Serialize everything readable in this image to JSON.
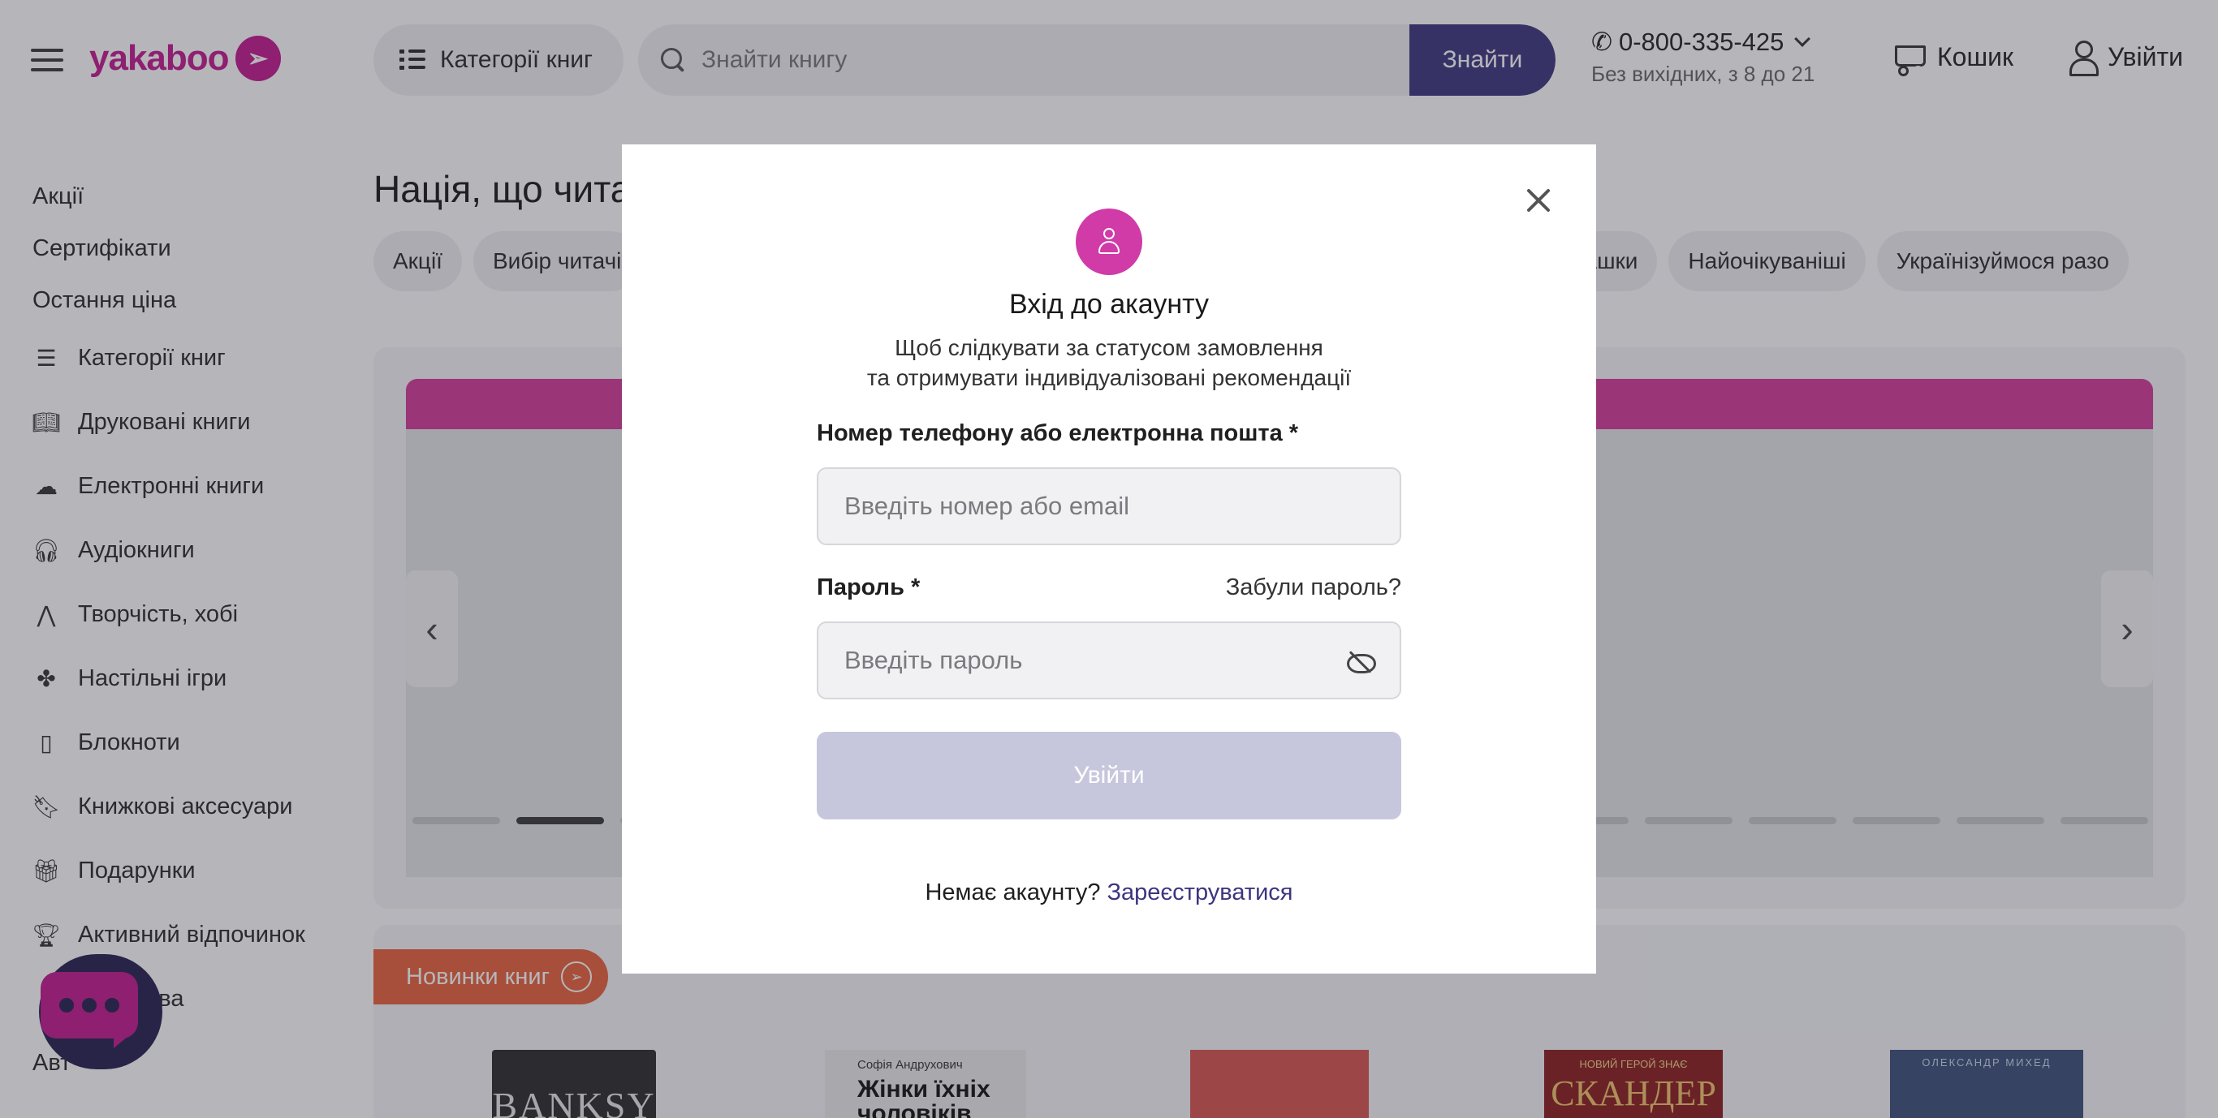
{
  "header": {
    "logo_text": "yakaboo",
    "categories_label": "Категорії книг",
    "search_placeholder": "Знайти книгу",
    "search_button": "Знайти",
    "phone": "0-800-335-425",
    "phone_hours": "Без вихідних, з 8 до 21",
    "cart_label": "Кошик",
    "login_label": "Увійти"
  },
  "sidebar": {
    "plain": [
      "Акції",
      "Сертифікати",
      "Остання ціна"
    ],
    "items": [
      {
        "label": "Категорії книг",
        "icon": "list-icon"
      },
      {
        "label": "Друковані книги",
        "icon": "book-icon"
      },
      {
        "label": "Електронні книги",
        "icon": "cloud-icon"
      },
      {
        "label": "Аудіокниги",
        "icon": "headphones-icon"
      },
      {
        "label": "Творчість, хобі",
        "icon": "compass-icon"
      },
      {
        "label": "Настільні ігри",
        "icon": "dice-icon"
      },
      {
        "label": "Блокноти",
        "icon": "notebook-icon"
      },
      {
        "label": "Книжкові аксесуари",
        "icon": "bookmark-icon"
      },
      {
        "label": "Подарунки",
        "icon": "gift-icon"
      },
      {
        "label": "Активний відпочинок",
        "icon": "trophy-icon"
      },
      {
        "label": "Вища ява",
        "icon": "star-icon"
      },
      {
        "label": "Авт",
        "icon": ""
      }
    ]
  },
  "main": {
    "title": "Нація, що чита",
    "chips": [
      "Акції",
      "Вибір читачі",
      "М'які іграшки",
      "Найочікуваніші",
      "Українізуймося разо"
    ],
    "new_books_label": "Новинки книг",
    "books": [
      {
        "cover_text": "BANKSY",
        "author": ""
      },
      {
        "cover_text": "Жінки їхніх чоловіків",
        "author": "Софія Андрухович"
      },
      {
        "cover_text": "",
        "author": ""
      },
      {
        "cover_text": "СКАНДЕР",
        "author": "НОВИЙ ГЕРОЙ ЗНАЄ"
      },
      {
        "cover_text": "",
        "author": "ОЛЕКСАНДР МИХЕД"
      }
    ]
  },
  "modal": {
    "title": "Вхід до акаунту",
    "subtitle_line1": "Щоб слідкувати за статусом замовлення",
    "subtitle_line2": "та отримувати індивідуалізовані рекомендації",
    "login_label": "Номер телефону або електронна пошта *",
    "login_placeholder": "Введіть номер або email",
    "password_label": "Пароль *",
    "forgot_label": "Забули пароль?",
    "password_placeholder": "Введіть пароль",
    "submit_label": "Увійти",
    "no_account": "Немає акаунту?",
    "register_label": "Зареєструватися"
  },
  "colors": {
    "brand": "#c2188f",
    "primary": "#3c357f",
    "submit_disabled": "#c6c7dc",
    "avatar": "#d03ba7"
  }
}
